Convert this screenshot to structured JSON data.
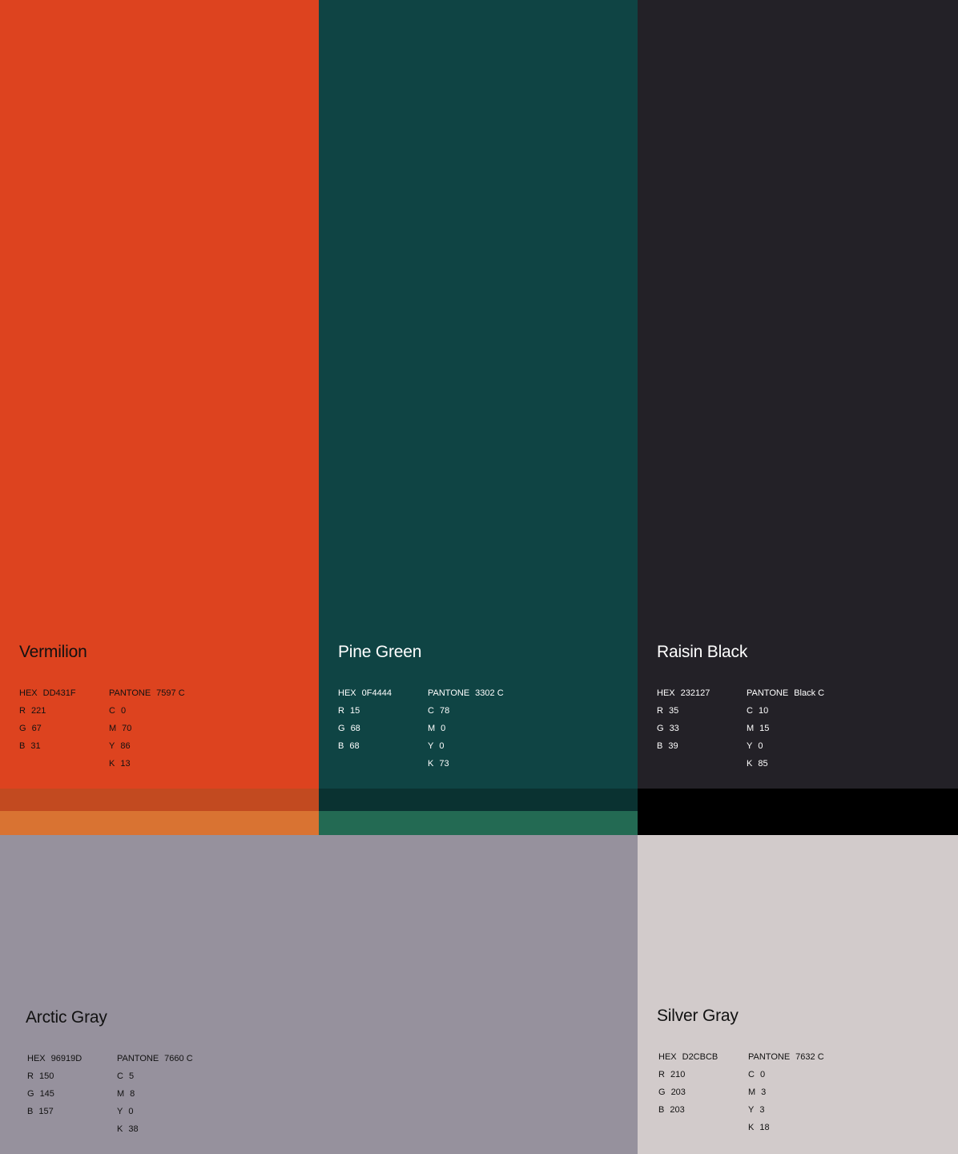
{
  "colors": {
    "vermilion": "#DD431F",
    "vermilion_shade": "#C24A20",
    "vermilion_tint": "#D97332",
    "pine_green": "#0F4444",
    "pine_green_shade": "#0A3231",
    "pine_green_tint": "#236A53",
    "raisin_black": "#232127",
    "raisin_black_shade": "#000000",
    "arctic_gray": "#96919D",
    "silver_gray": "#D2CBCB"
  },
  "swatches": {
    "vermilion": {
      "name": "Vermilion",
      "hex_label": "HEX",
      "hex": "DD431F",
      "r_label": "R",
      "r": "221",
      "g_label": "G",
      "g": "67",
      "b_label": "B",
      "b": "31",
      "pantone_label": "PANTONE",
      "pantone": "7597 C",
      "c_label": "C",
      "c": "0",
      "m_label": "M",
      "m": "70",
      "y_label": "Y",
      "y": "86",
      "k_label": "K",
      "k": "13"
    },
    "pine_green": {
      "name": "Pine Green",
      "hex_label": "HEX",
      "hex": "0F4444",
      "r_label": "R",
      "r": "15",
      "g_label": "G",
      "g": "68",
      "b_label": "B",
      "b": "68",
      "pantone_label": "PANTONE",
      "pantone": "3302 C",
      "c_label": "C",
      "c": "78",
      "m_label": "M",
      "m": "0",
      "y_label": "Y",
      "y": "0",
      "k_label": "K",
      "k": "73"
    },
    "raisin_black": {
      "name": "Raisin Black",
      "hex_label": "HEX",
      "hex": "232127",
      "r_label": "R",
      "r": "35",
      "g_label": "G",
      "g": "33",
      "b_label": "B",
      "b": "39",
      "pantone_label": "PANTONE",
      "pantone": "Black C",
      "c_label": "C",
      "c": "10",
      "m_label": "M",
      "m": "15",
      "y_label": "Y",
      "y": "0",
      "k_label": "K",
      "k": "85"
    },
    "arctic_gray": {
      "name": "Arctic Gray",
      "hex_label": "HEX",
      "hex": "96919D",
      "r_label": "R",
      "r": "150",
      "g_label": "G",
      "g": "145",
      "b_label": "B",
      "b": "157",
      "pantone_label": "PANTONE",
      "pantone": "7660 C",
      "c_label": "C",
      "c": "5",
      "m_label": "M",
      "m": "8",
      "y_label": "Y",
      "y": "0",
      "k_label": "K",
      "k": "38"
    },
    "silver_gray": {
      "name": "Silver Gray",
      "hex_label": "HEX",
      "hex": "D2CBCB",
      "r_label": "R",
      "r": "210",
      "g_label": "G",
      "g": "203",
      "b_label": "B",
      "b": "203",
      "pantone_label": "PANTONE",
      "pantone": "7632 C",
      "c_label": "C",
      "c": "0",
      "m_label": "M",
      "m": "3",
      "y_label": "Y",
      "y": "3",
      "k_label": "K",
      "k": "18"
    }
  }
}
